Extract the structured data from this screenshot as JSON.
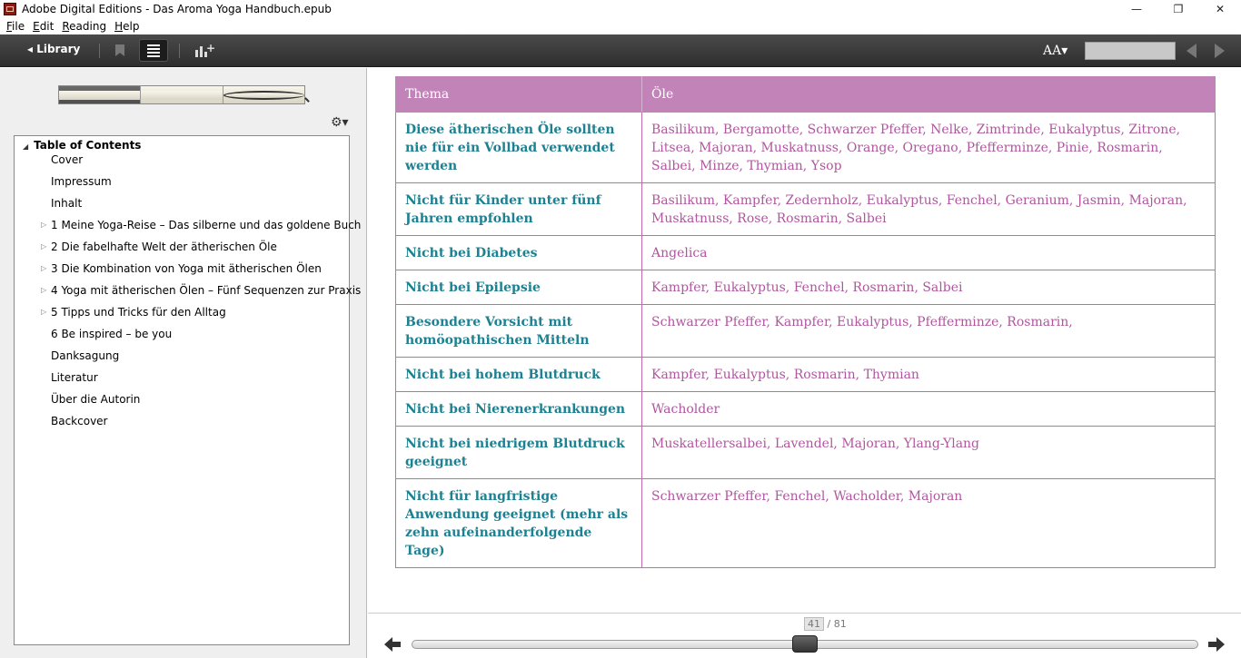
{
  "window": {
    "title": "Adobe Digital Editions - Das Aroma Yoga Handbuch.epub",
    "minimize_icon": "minimize-icon",
    "restore_icon": "restore-icon",
    "close_icon": "close-icon"
  },
  "menu": [
    {
      "label": "File",
      "accel": "F",
      "rest": "ile"
    },
    {
      "label": "Edit",
      "accel": "E",
      "rest": "dit"
    },
    {
      "label": "Reading",
      "accel": "R",
      "rest": "eading"
    },
    {
      "label": "Help",
      "accel": "H",
      "rest": "elp"
    }
  ],
  "toolbar": {
    "library_label": "◂ Library",
    "font_label": "AA▾"
  },
  "left_panel": {
    "settings_icon": "⚙▾",
    "toc_title": "Table of Contents",
    "toc_items": [
      {
        "label": "Cover",
        "expandable": false
      },
      {
        "label": "Impressum",
        "expandable": false
      },
      {
        "label": "Inhalt",
        "expandable": false
      },
      {
        "label": "1 Meine Yoga-Reise – Das silberne und das goldene Buch",
        "expandable": true
      },
      {
        "label": "2 Die fabelhafte Welt der ätherischen Öle",
        "expandable": true
      },
      {
        "label": "3 Die Kombination von Yoga mit ätherischen Ölen",
        "expandable": true
      },
      {
        "label": "4 Yoga mit ätherischen Ölen – Fünf Sequenzen zur Praxis",
        "expandable": true
      },
      {
        "label": "5 Tipps und Tricks für den Alltag",
        "expandable": true
      },
      {
        "label": "6 Be inspired – be you",
        "expandable": false
      },
      {
        "label": "Danksagung",
        "expandable": false
      },
      {
        "label": "Literatur",
        "expandable": false
      },
      {
        "label": "Über die Autorin",
        "expandable": false
      },
      {
        "label": "Backcover",
        "expandable": false
      }
    ]
  },
  "content": {
    "table": {
      "headers": [
        "Thema",
        "Öle"
      ],
      "rows": [
        [
          "Diese ätherischen Öle sollten nie für ein Vollbad verwendet werden",
          "Basilikum, Bergamotte, Schwarzer Pfeffer, Nelke, Zimtrinde, Eukalyptus, Zitrone, Litsea, Majoran, Muskatnuss, Orange, Oregano, Pfefferminze, Pinie, Rosmarin, Salbei, Minze, Thymian, Ysop"
        ],
        [
          "Nicht für Kinder unter fünf Jahren empfohlen",
          "Basilikum, Kampfer, Zedernholz, Eukalyptus, Fenchel, Geranium, Jasmin, Majoran, Muskatnuss, Rose, Rosmarin, Salbei"
        ],
        [
          "Nicht bei Diabetes",
          "Angelica"
        ],
        [
          "Nicht bei Epilepsie",
          "Kampfer, Eukalyptus, Fenchel, Rosmarin, Salbei"
        ],
        [
          "Besondere Vorsicht mit homöopathischen Mitteln",
          "Schwarzer Pfeffer, Kampfer, Eukalyptus, Pfefferminze, Rosmarin,"
        ],
        [
          "Nicht bei hohem Blutdruck",
          "Kampfer, Eukalyptus, Rosmarin, Thymian"
        ],
        [
          "Nicht bei Nierenerkrankungen",
          "Wacholder"
        ],
        [
          "Nicht bei niedrigem Blutdruck geeignet",
          "Muskatellersalbei, Lavendel, Majoran, Ylang-Ylang"
        ],
        [
          "Nicht für langfristige Anwendung geeignet (mehr als zehn aufeinanderfolgende Tage)",
          "Schwarzer Pfeffer, Fenchel, Wacholder, Majoran"
        ]
      ]
    }
  },
  "pager": {
    "current": "41",
    "total_label": "/ 81",
    "progress_fraction": 0.5
  },
  "colors": {
    "header_bg": "#c183b8",
    "topic_text": "#1e8191",
    "value_text": "#b0569e"
  }
}
